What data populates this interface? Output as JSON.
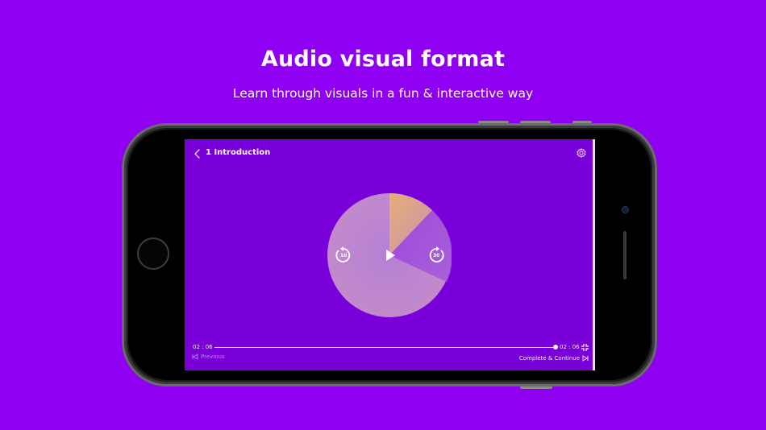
{
  "promo": {
    "headline": "Audio visual format",
    "subline": "Learn through visuals in a fun & interactive way"
  },
  "player": {
    "title": "1 Introduction",
    "time_current": "02 : 06",
    "time_total": "02 : 06",
    "progress": 1.0,
    "rewind_seconds": "10",
    "forward_seconds": "30",
    "previous_label": "Previous",
    "next_label": "Complete & Continue"
  },
  "icons": {
    "back": "chevron-left-icon",
    "settings": "gear-icon",
    "play": "play-icon",
    "rewind": "rewind-10-icon",
    "forward": "forward-30-icon",
    "fullscreen": "exit-fullscreen-icon",
    "previous": "skip-previous-icon",
    "next": "skip-next-icon"
  },
  "colors": {
    "background": "#8F00F2",
    "screen": "#7A00D9",
    "wedge": "#D9A27E",
    "disc": "#B37AC9"
  }
}
